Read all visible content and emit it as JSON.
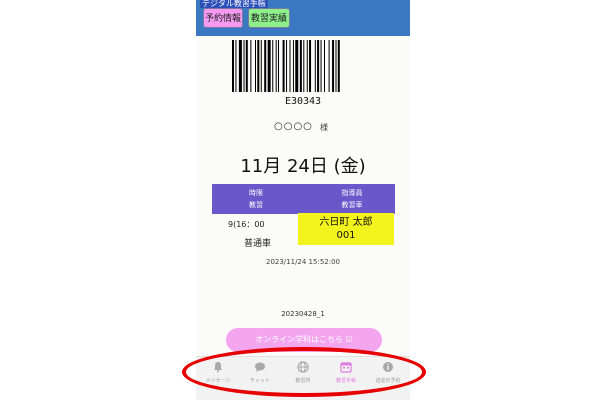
{
  "header": {
    "title": "デジタル教習手帳",
    "tabs": [
      {
        "label": "予約情報",
        "color": "#f59af0"
      },
      {
        "label": "教習実績",
        "color": "#8ef08a"
      }
    ]
  },
  "ticket": {
    "barcode_number": "E30343",
    "student_name": "○○○○",
    "honorific": "様",
    "date": "11月 24日 (金)",
    "columns": {
      "left_line1": "時限",
      "left_line2": "教習",
      "right_line1": "指導員",
      "right_line2": "教習車"
    },
    "time": "9(16：00",
    "vehicle": "普通車",
    "instructor_name": "六日町 太郎",
    "car_number": "001",
    "timestamp": "2023/11/24 15:52:00",
    "version_code": "20230428_1"
  },
  "online_button": {
    "label": "オンライン学科はこちら ☑"
  },
  "nav": [
    {
      "label": "メッセージ",
      "icon": "bell-icon",
      "active": false
    },
    {
      "label": "チャット",
      "icon": "chat-bubble-icon",
      "active": false
    },
    {
      "label": "教習所",
      "icon": "globe-icon",
      "active": false
    },
    {
      "label": "教習手帳",
      "icon": "calendar-icon",
      "active": true
    },
    {
      "label": "送迎の予約",
      "icon": "info-icon",
      "active": false
    }
  ],
  "colors": {
    "header": "#3b78c2",
    "band": "#6a57c9",
    "instructor_highlight": "#f2f21c",
    "accent_pink": "#f3a6ee",
    "annotation": "#e60000"
  }
}
